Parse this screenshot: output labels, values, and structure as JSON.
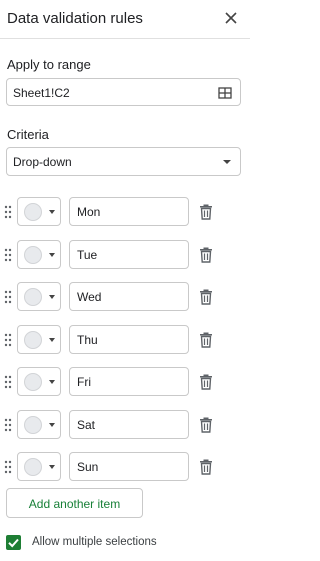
{
  "panel": {
    "title": "Data validation rules"
  },
  "apply_to_range": {
    "label": "Apply to range",
    "value": "Sheet1!C2"
  },
  "criteria": {
    "label": "Criteria",
    "selected": "Drop-down"
  },
  "items": [
    {
      "value": "Mon",
      "color": "#e8eaed"
    },
    {
      "value": "Tue",
      "color": "#e8eaed"
    },
    {
      "value": "Wed",
      "color": "#e8eaed"
    },
    {
      "value": "Thu",
      "color": "#e8eaed"
    },
    {
      "value": "Fri",
      "color": "#e8eaed"
    },
    {
      "value": "Sat",
      "color": "#e8eaed"
    },
    {
      "value": "Sun",
      "color": "#e8eaed"
    }
  ],
  "add_item": {
    "label": "Add another item"
  },
  "allow_multiple": {
    "label": "Allow multiple selections",
    "checked": true
  },
  "colors": {
    "accent": "#188038",
    "checkbox": "#1e7e34",
    "border": "#c9c9c9"
  },
  "icons": {
    "close": "close-icon",
    "range": "grid-icon",
    "drag": "drag-handle-icon",
    "delete": "trash-icon",
    "check": "checkmark-icon"
  }
}
